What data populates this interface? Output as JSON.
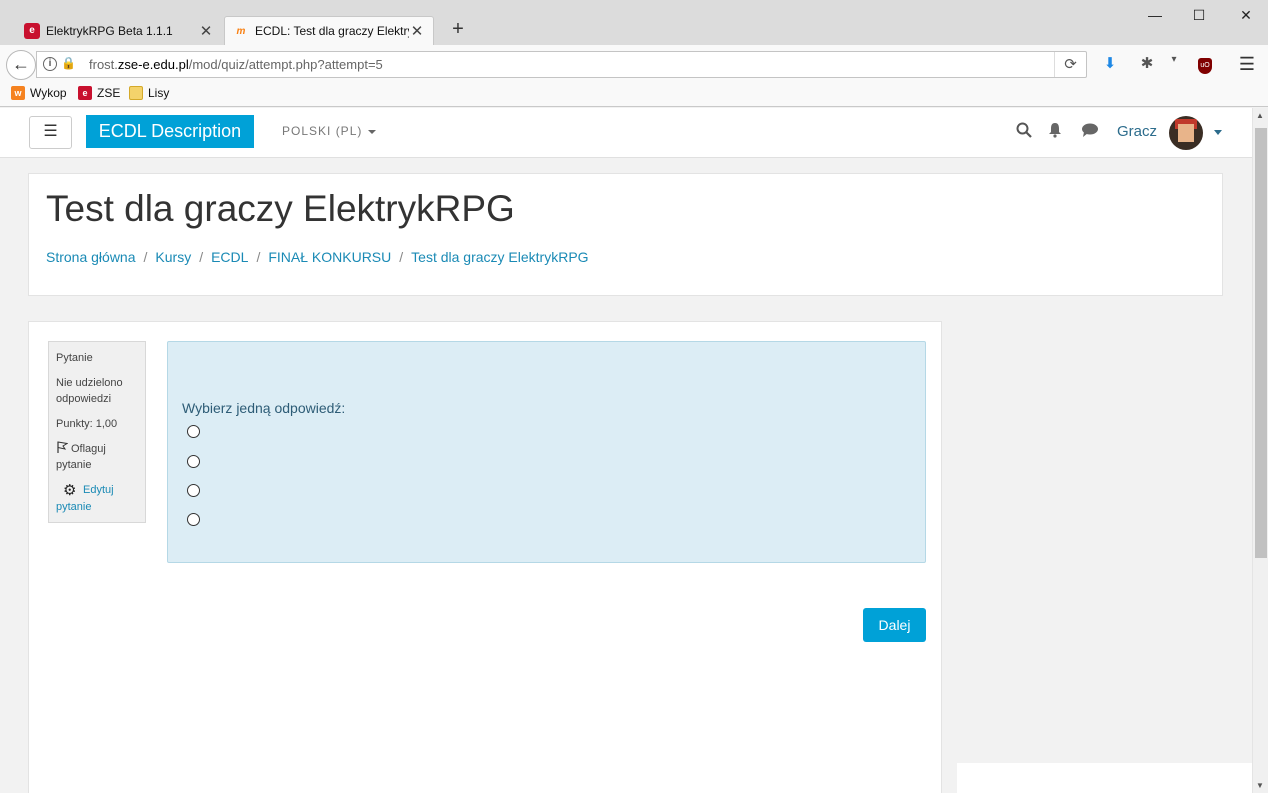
{
  "browser": {
    "tabs": [
      {
        "title": "ElektrykRPG Beta 1.1.1",
        "favicon": "elektrykrpg-favicon",
        "active": false
      },
      {
        "title": "ECDL: Test dla graczy ElektrykRPG",
        "favicon": "moodle-favicon",
        "active": true
      }
    ],
    "new_tab_label": "+",
    "url": {
      "host_prefix": "frost.",
      "host": "zse-e.edu.pl",
      "path": "/mod/quiz/attempt.php?attempt=5"
    },
    "bookmarks": [
      {
        "label": "Wykop",
        "icon": "wykop-icon"
      },
      {
        "label": "ZSE",
        "icon": "zse-icon"
      },
      {
        "label": "Lisy",
        "icon": "folder-icon"
      }
    ]
  },
  "site": {
    "brand": "ECDL Description",
    "language": "POLSKI (PL)",
    "user_name": "Gracz"
  },
  "page": {
    "title": "Test dla graczy ElektrykRPG",
    "breadcrumb": [
      "Strona główna",
      "Kursy",
      "ECDL",
      "FINAŁ KONKURSU",
      "Test dla graczy ElektrykRPG"
    ]
  },
  "question": {
    "label": "Pytanie",
    "status": "Nie udzielono odpowiedzi",
    "points": "Punkty: 1,00",
    "flag_label": "Oflaguj pytanie",
    "edit_label": "Edytuj pytanie",
    "prompt": "Wybierz jedną odpowiedź:",
    "options": [
      "",
      "",
      "",
      ""
    ]
  },
  "actions": {
    "next": "Dalej"
  },
  "colors": {
    "brand": "#00a1d7",
    "question_bg": "#dcedf5",
    "link": "#1a8ab5"
  }
}
